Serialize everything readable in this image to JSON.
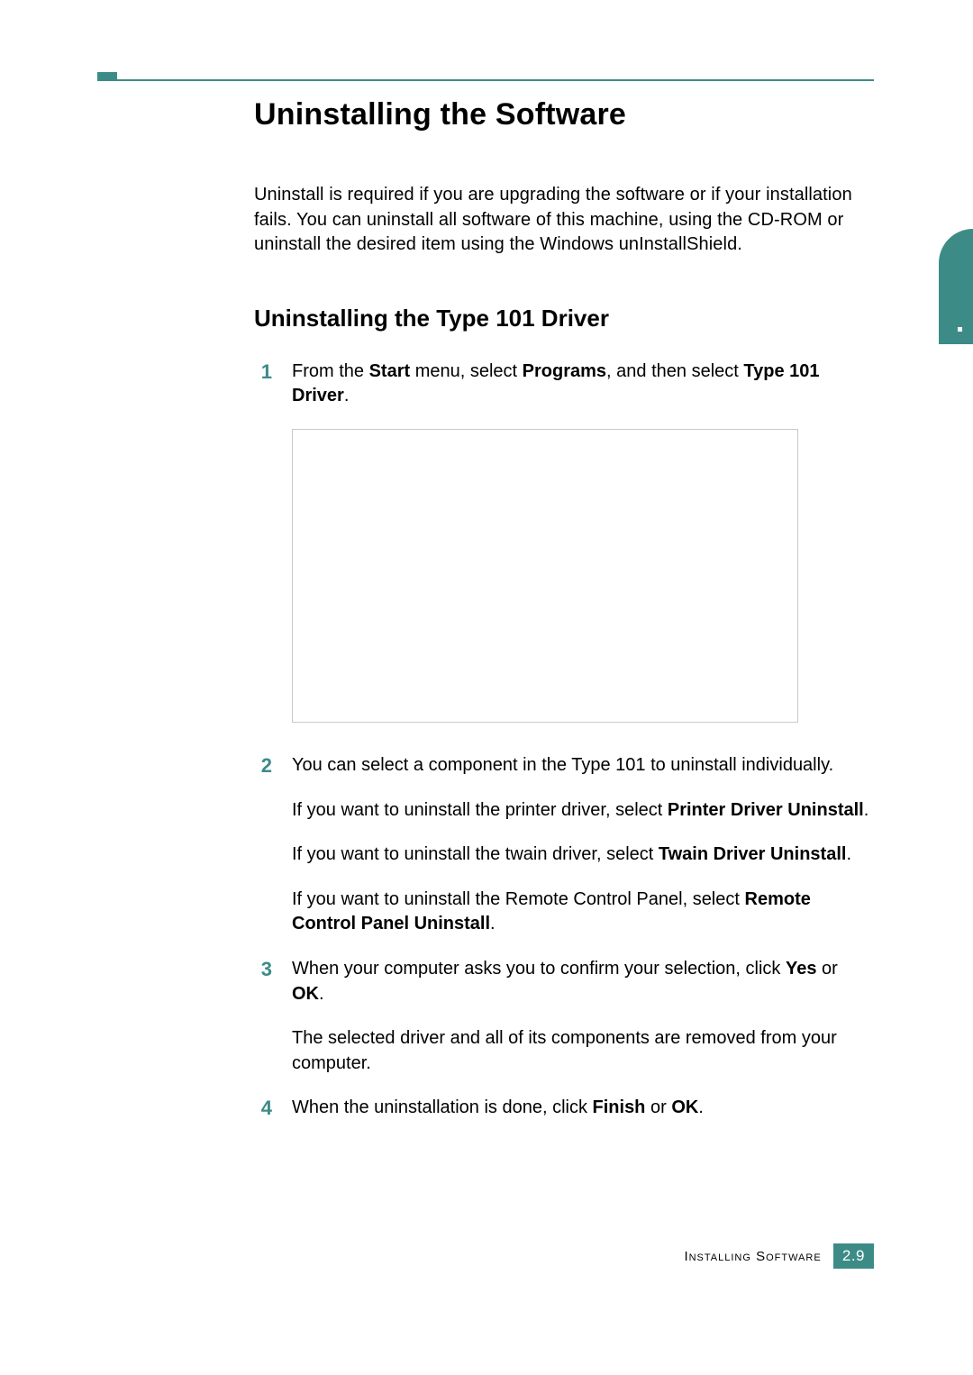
{
  "title": "Uninstalling the Software",
  "intro": "Uninstall is required if you are upgrading the software or if your installation fails. You can uninstall all software of this machine, using the CD-ROM or uninstall the desired item using the Windows unInstallShield.",
  "subtitle": "Uninstalling the Type  101 Driver",
  "steps": {
    "s1": {
      "num": "1",
      "p1_a": "From the ",
      "p1_b": "Start",
      "p1_c": " menu, select ",
      "p1_d": "Programs",
      "p1_e": ", and then select ",
      "p1_f": "Type 101 Driver",
      "p1_g": "."
    },
    "s2": {
      "num": "2",
      "p1": "You can select a component in the Type 101 to uninstall individually.",
      "p2_a": "If you want to uninstall the printer driver, select ",
      "p2_b": "Printer Driver Uninstall",
      "p2_c": ".",
      "p3_a": "If you want to uninstall the twain driver, select ",
      "p3_b": "Twain Driver Uninstall",
      "p3_c": ".",
      "p4_a": "If you want to uninstall the Remote Control Panel, select ",
      "p4_b": "Remote Control Panel Uninstall",
      "p4_c": "."
    },
    "s3": {
      "num": "3",
      "p1_a": "When your computer asks you to confirm your selection, click ",
      "p1_b": "Yes",
      "p1_c": " or ",
      "p1_d": "OK",
      "p1_e": ".",
      "p2": "The selected driver and all of its components are removed from your computer."
    },
    "s4": {
      "num": "4",
      "p1_a": "When the uninstallation is done, click ",
      "p1_b": "Finish",
      "p1_c": " or ",
      "p1_d": "OK",
      "p1_e": "."
    }
  },
  "footer": {
    "label": "Installing Software",
    "page": "2.9"
  }
}
